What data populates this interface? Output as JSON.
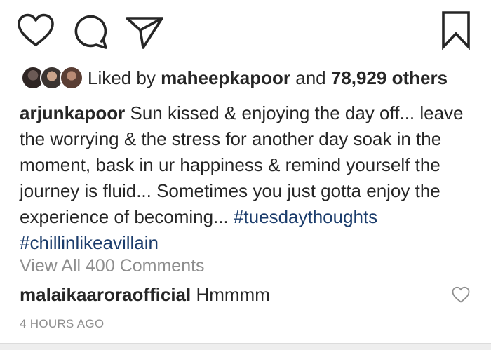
{
  "actions": {
    "like_icon": "heart-outline-icon",
    "comment_icon": "speech-bubble-icon",
    "share_icon": "paper-plane-icon",
    "save_icon": "bookmark-outline-icon"
  },
  "likes": {
    "prefix": "Liked by ",
    "user": "maheepkapoor",
    "connector": " and ",
    "count": "78,929 others"
  },
  "caption": {
    "username": "arjunkapoor",
    "text": " Sun kissed & enjoying the day off... leave the worrying & the stress for another day soak in the moment, bask in ur happiness & remind yourself the journey is fluid... Sometimes you just gotta enjoy the experience of becoming... ",
    "hashtags": [
      "#tuesdaythoughts",
      "#chillinlikeavillain"
    ]
  },
  "comments": {
    "view_all_label": "View All 400 Comments",
    "items": [
      {
        "username": "malaikaaroraofficial",
        "text": "Hmmmm"
      }
    ]
  },
  "timestamp": "4 HOURS AGO",
  "colors": {
    "text": "#262626",
    "muted": "#8e8e8e",
    "hashtag": "#1c3d6c"
  }
}
